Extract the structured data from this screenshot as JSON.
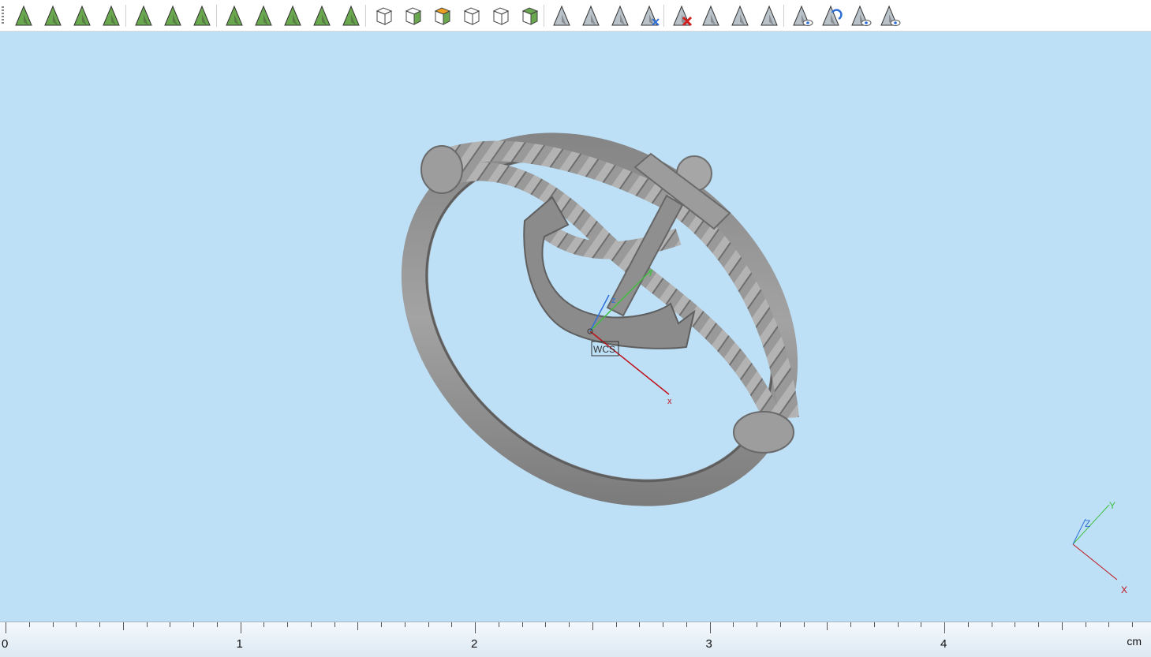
{
  "toolbar": {
    "groups": [
      [
        "select-object-icon",
        "select-face-icon",
        "select-curve-icon",
        "select-sphere-icon"
      ],
      [
        "rectangle-select-icon",
        "freeform-select-icon",
        "curve-select-icon"
      ],
      [
        "mesh-select-icon",
        "network-select-icon",
        "fan-select-icon",
        "circle-grid-icon",
        "circle-segment-icon"
      ],
      [
        "cube-outline-icon",
        "cube-shaded-icon",
        "cube-color-icon",
        "cube-wire-icon",
        "cube-cut-icon",
        "cube-green-icon"
      ],
      [
        "point-select-icon",
        "point-deselect-icon",
        "point-grow-icon",
        "point-swap-icon"
      ],
      [
        "delete-point-icon",
        "hide-point-icon",
        "copy-point-icon",
        "flatten-point-icon"
      ],
      [
        "view-point-icon",
        "view-refresh-icon",
        "view-eye-icon",
        "view-hidden-icon"
      ]
    ]
  },
  "viewport": {
    "wcs_label": "WCS",
    "origin_axes": {
      "x": "x",
      "y": "y",
      "z": "z"
    },
    "corner_axes": {
      "x": "X",
      "y": "Y",
      "z": "Z"
    }
  },
  "ruler": {
    "labels": [
      "0",
      "1",
      "2",
      "3",
      "4"
    ],
    "unit": "cm"
  },
  "colors": {
    "background": "#bde0f7",
    "model": "#8a8a8a",
    "axis_x": "#c0111a",
    "axis_y": "#3fbf3f",
    "axis_z": "#2d6fd6",
    "icon_green": "#6aa84f"
  }
}
